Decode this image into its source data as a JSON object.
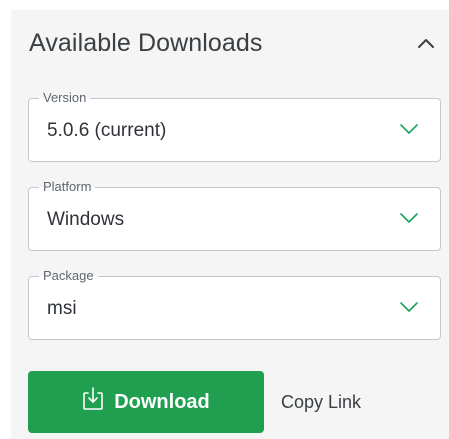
{
  "panel": {
    "title": "Available Downloads",
    "collapse_icon": "chevron-up-icon"
  },
  "fields": {
    "version": {
      "label": "Version",
      "value": "5.0.6 (current)",
      "icon": "chevron-down-icon"
    },
    "platform": {
      "label": "Platform",
      "value": "Windows",
      "icon": "chevron-down-icon"
    },
    "package": {
      "label": "Package",
      "value": "msi",
      "icon": "chevron-down-icon"
    }
  },
  "actions": {
    "download_label": "Download",
    "download_icon": "download-icon",
    "copy_link_label": "Copy Link"
  },
  "colors": {
    "accent": "#1f9f4f",
    "chevron": "#19a35a",
    "panel_bg": "#f4f5f4",
    "border": "#c4c8cc"
  }
}
